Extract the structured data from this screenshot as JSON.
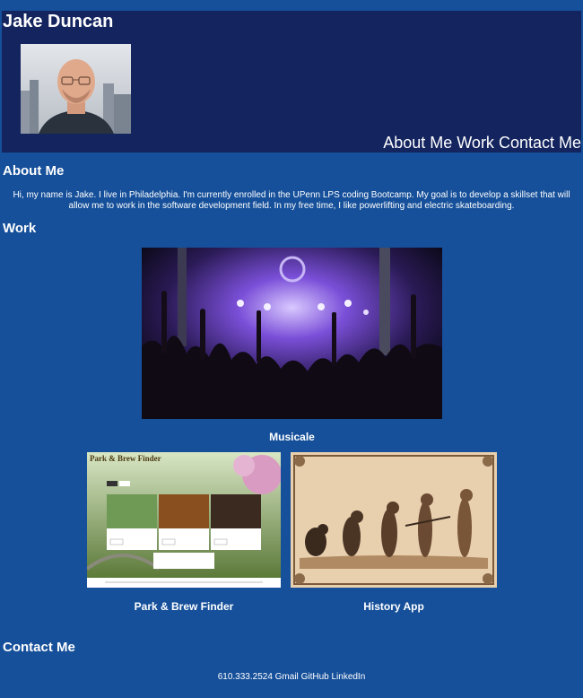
{
  "header": {
    "title": "Jake Duncan",
    "nav": [
      "About Me",
      "Work",
      "Contact Me"
    ]
  },
  "about": {
    "heading": "About Me",
    "text": "Hi, my name is Jake. I live in Philadelphia. I'm currently enrolled in the UPenn LPS coding Bootcamp. My goal is to develop a skillset that will allow me to work in the software development field. In my free time, I like powerlifting and electric skateboarding."
  },
  "work": {
    "heading": "Work",
    "projects": [
      {
        "label": "Musicale",
        "thumb_title": ""
      },
      {
        "label": "Park & Brew Finder",
        "thumb_title": "Park & Brew Finder"
      },
      {
        "label": "History App",
        "thumb_title": ""
      }
    ]
  },
  "contact": {
    "heading": "Contact Me",
    "phone": "610.333.2524",
    "links": [
      "Gmail",
      "GitHub",
      "LinkedIn"
    ]
  },
  "colors": {
    "page_bg": "#16509a",
    "header_bg": "#13245e",
    "text": "#ffffff"
  }
}
